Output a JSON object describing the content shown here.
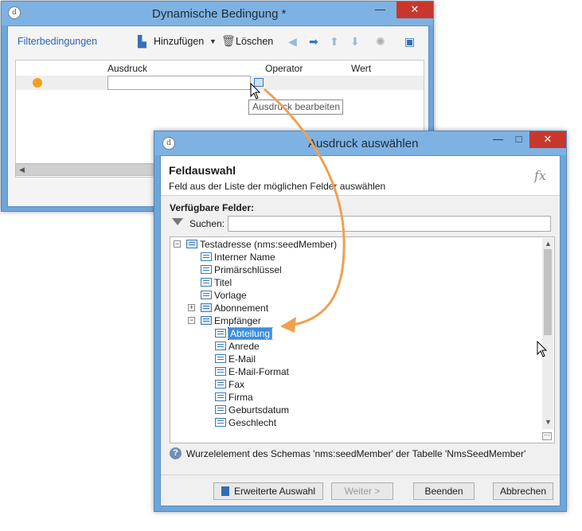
{
  "window1": {
    "title": "Dynamische Bedingung *",
    "toolbar": {
      "filter_label": "Filterbedingungen",
      "add_label": "Hinzufügen",
      "delete_label": "Löschen"
    },
    "grid": {
      "columns": [
        "Ausdruck",
        "Operator",
        "Wert"
      ]
    },
    "tooltip": "Ausdruck bearbeiten"
  },
  "window2": {
    "title": "Ausdruck auswählen",
    "header_title": "Feldauswahl",
    "header_subtitle": "Feld aus der Liste der möglichen Felder auswählen",
    "fx_label": "fx",
    "available_label": "Verfügbare Felder:",
    "search_label": "Suchen:",
    "search_value": "",
    "tree": [
      {
        "label": "Testadresse (nms:seedMember)"
      },
      {
        "label": "Interner Name"
      },
      {
        "label": "Primärschlüssel"
      },
      {
        "label": "Titel"
      },
      {
        "label": "Vorlage"
      },
      {
        "label": "Abonnement"
      },
      {
        "label": "Empfänger"
      },
      {
        "label": "Abteilung"
      },
      {
        "label": "Anrede"
      },
      {
        "label": "E-Mail"
      },
      {
        "label": "E-Mail-Format"
      },
      {
        "label": "Fax"
      },
      {
        "label": "Firma"
      },
      {
        "label": "Geburtsdatum"
      },
      {
        "label": "Geschlecht"
      }
    ],
    "info_text": "Wurzelelement des Schemas 'nms:seedMember' der Tabelle 'NmsSeedMember'",
    "buttons": {
      "advanced": "Erweiterte Auswahl",
      "next": "Weiter >",
      "finish": "Beenden",
      "cancel": "Abbrechen"
    }
  },
  "colors": {
    "frame": "#7eb2e2",
    "close": "#c7372e",
    "selection": "#3b8ede",
    "arrow": "#f0a050"
  }
}
